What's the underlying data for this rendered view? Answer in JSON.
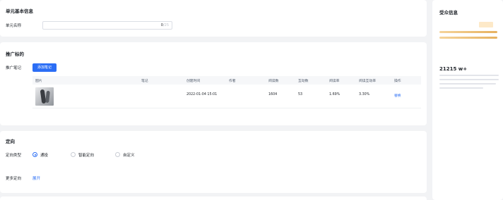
{
  "basic": {
    "title": "单元基本信息",
    "name_label": "单元名称",
    "name_placeholder": "",
    "name_count": "0",
    "name_max": "/25"
  },
  "promo": {
    "title": "推广标的",
    "note_label": "推广笔记",
    "add_button": "添加笔记",
    "columns": [
      "图片",
      "笔记",
      "创建时间",
      "作者",
      "阅读数",
      "互动数",
      "阅读率",
      "阅读互动率",
      "操作"
    ],
    "rows": [
      {
        "note": "",
        "created": "2022-01-04 15:01",
        "author": "",
        "reads": "1604",
        "interactions": "53",
        "read_rate": "1.69%",
        "interaction_rate": "3.30%",
        "action": "替换"
      }
    ],
    "tip": ""
  },
  "targeting": {
    "title": "定向",
    "type_label": "定向类型",
    "options": [
      {
        "label": "通投",
        "selected": true
      },
      {
        "label": "智能定向",
        "selected": false
      },
      {
        "label": "自定义",
        "selected": false
      }
    ],
    "more_label": "更多定向",
    "expand": "展开"
  },
  "audience": {
    "title": "受众信息",
    "scope_label": "",
    "scope_tag": "",
    "gauge_low": "",
    "gauge_high": "",
    "size_label": "",
    "size_value": "21215 w+"
  },
  "colors": {
    "accent": "#2b6ef5",
    "gauge": "#e6b15f",
    "tag_bg": "#fde9c8"
  }
}
